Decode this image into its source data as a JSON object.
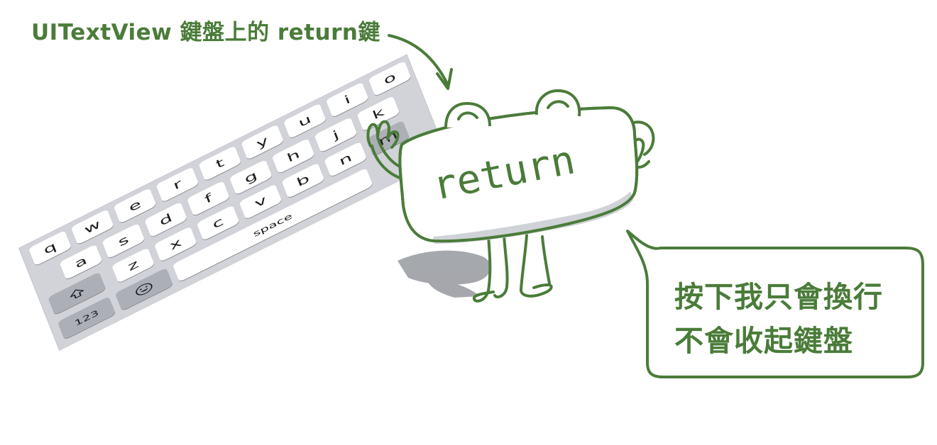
{
  "caption": "UITextView 鍵盤上的 return鍵",
  "mascot": {
    "label": "return"
  },
  "speech_bubble": {
    "line1": "按下我只會換行",
    "line2": "不會收起鍵盤"
  },
  "keyboard": {
    "row1": [
      "q",
      "w",
      "e",
      "r",
      "t",
      "y",
      "u",
      "i",
      "o"
    ],
    "row2": [
      "a",
      "s",
      "d",
      "f",
      "g",
      "h",
      "j",
      "k"
    ],
    "row3": [
      "z",
      "x",
      "c",
      "v",
      "b",
      "n",
      "m"
    ],
    "space_label": "space",
    "numbers_label": "123",
    "shift_icon": "shift-arrow",
    "emoji_icon": "smiley-face"
  },
  "colors": {
    "accent": "#4a7c39",
    "keyboard_bg": "#d1d3d9",
    "key_bg": "#ffffff",
    "dark_key_bg": "#acafb6"
  }
}
